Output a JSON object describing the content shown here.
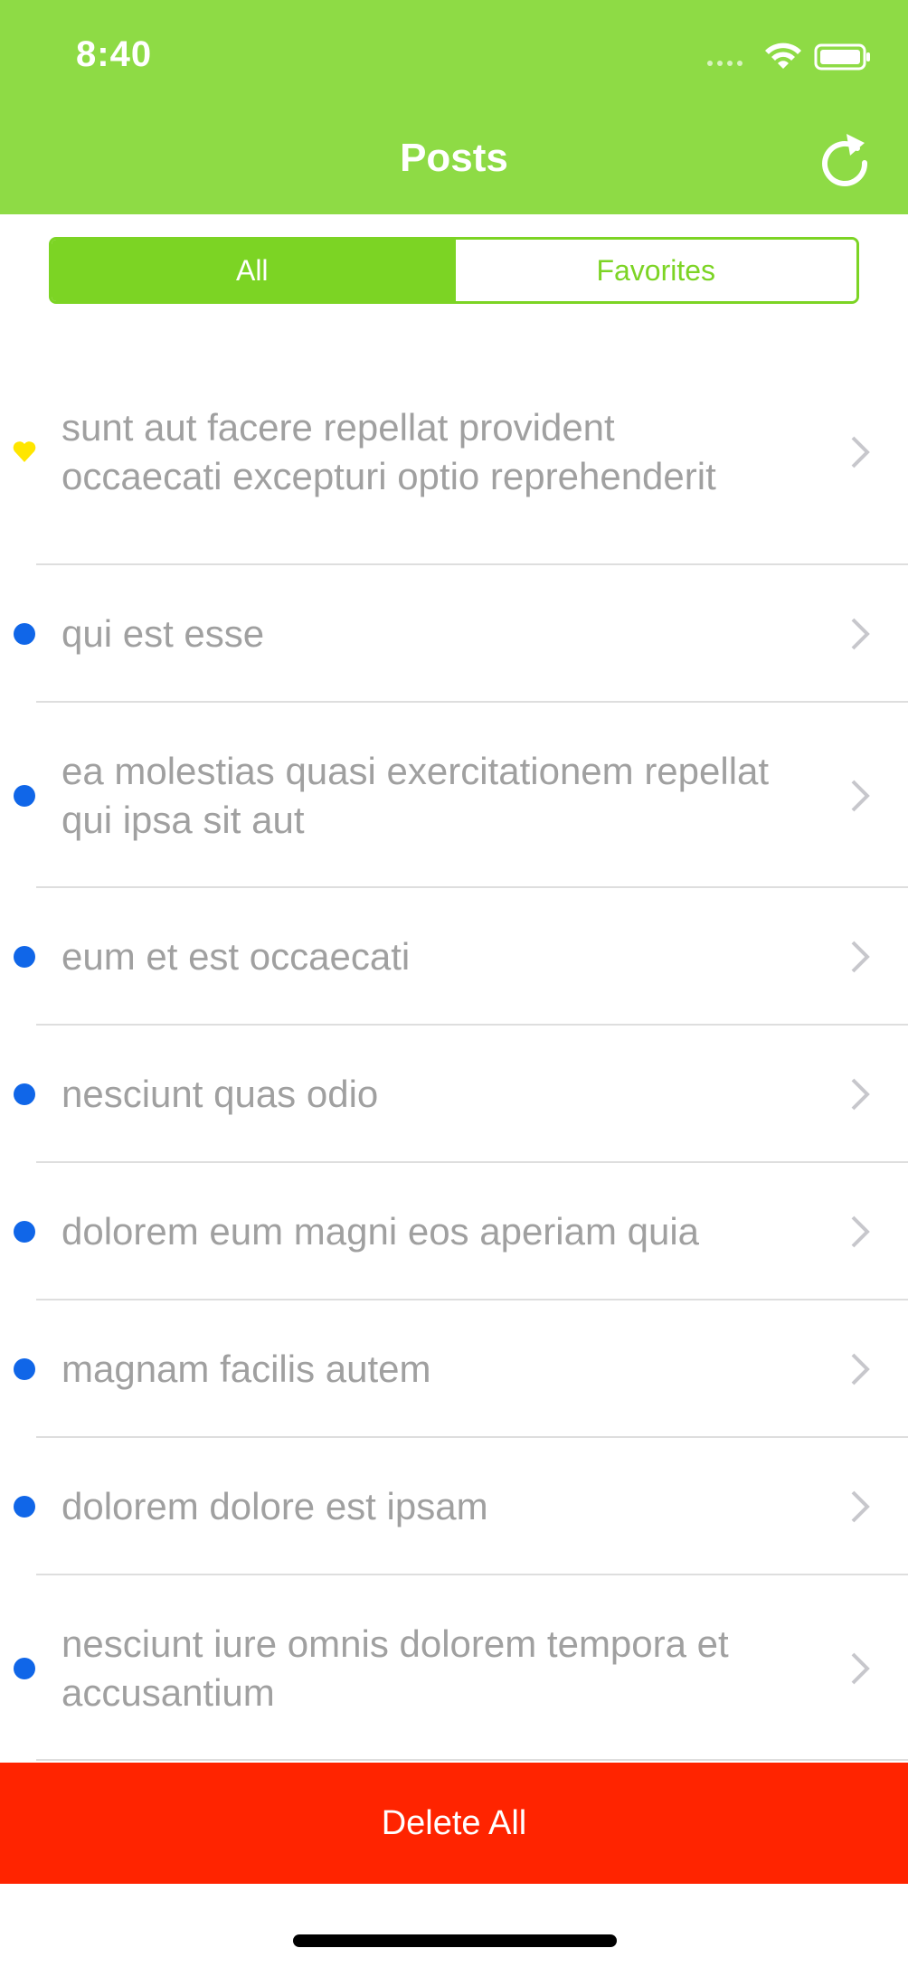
{
  "status_bar": {
    "time": "8:40"
  },
  "nav": {
    "title": "Posts",
    "refresh_icon": "refresh-icon"
  },
  "segments": {
    "all": "All",
    "favorites": "Favorites",
    "selected": "All"
  },
  "posts": [
    {
      "title": "sunt aut facere repellat provident occaecati excepturi optio reprehenderit",
      "marker": "heart",
      "marker_color": "#ffe600"
    },
    {
      "title": "qui est esse",
      "marker": "dot",
      "marker_color": "#1066e8"
    },
    {
      "title": "ea molestias quasi exercitationem repellat qui ipsa sit aut",
      "marker": "dot",
      "marker_color": "#1066e8"
    },
    {
      "title": "eum et est occaecati",
      "marker": "dot",
      "marker_color": "#1066e8"
    },
    {
      "title": "nesciunt quas odio",
      "marker": "dot",
      "marker_color": "#1066e8"
    },
    {
      "title": "dolorem eum magni eos aperiam quia",
      "marker": "dot",
      "marker_color": "#1066e8"
    },
    {
      "title": "magnam facilis autem",
      "marker": "dot",
      "marker_color": "#1066e8"
    },
    {
      "title": "dolorem dolore est ipsam",
      "marker": "dot",
      "marker_color": "#1066e8"
    },
    {
      "title": "nesciunt iure omnis dolorem tempora et accusantium",
      "marker": "dot",
      "marker_color": "#1066e8"
    }
  ],
  "footer": {
    "delete_label": "Delete All"
  },
  "colors": {
    "header": "#8edb45",
    "accent": "#7cd424",
    "delete": "#ff2400",
    "unread_dot": "#1066e8",
    "favorite": "#ffe600"
  }
}
